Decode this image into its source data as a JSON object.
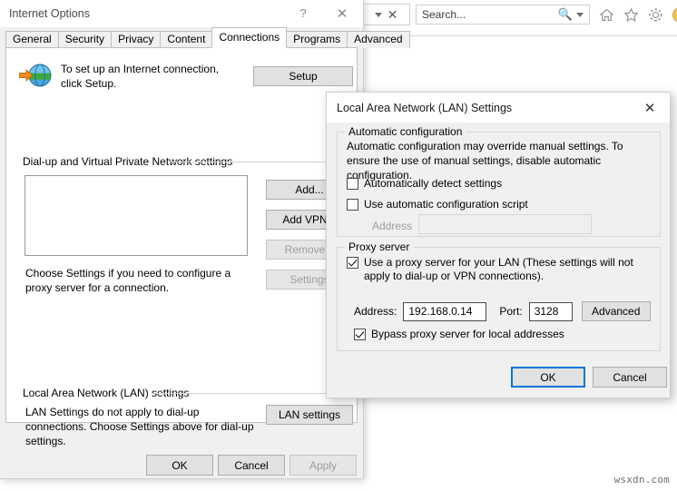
{
  "browser": {
    "address_controls": {
      "dropdown_icon": "chevron-down-icon",
      "close_icon": "close-icon"
    },
    "search": {
      "placeholder": "Search...",
      "magnifier_icon": "search-icon",
      "dropdown_icon": "chevron-down-icon"
    },
    "icons": [
      "home-icon",
      "favorites-star-icon",
      "gear-icon",
      "account-circle-icon"
    ]
  },
  "internet_options": {
    "title": "Internet Options",
    "help_button": "?",
    "close_button": "✕",
    "tabs": [
      {
        "label": "General",
        "active": false
      },
      {
        "label": "Security",
        "active": false
      },
      {
        "label": "Privacy",
        "active": false
      },
      {
        "label": "Content",
        "active": false
      },
      {
        "label": "Connections",
        "active": true
      },
      {
        "label": "Programs",
        "active": false
      },
      {
        "label": "Advanced",
        "active": false
      }
    ],
    "setup": {
      "icon": "globe-with-arrow-icon",
      "text": "To set up an Internet connection, click Setup.",
      "button": "Setup"
    },
    "dialup": {
      "group_label": "Dial-up and Virtual Private Network settings",
      "list_items": [],
      "help_text": "Choose Settings if you need to configure a proxy server for a connection.",
      "buttons": [
        {
          "label": "Add...",
          "disabled": false
        },
        {
          "label": "Add VPN...",
          "disabled": false
        },
        {
          "label": "Remove...",
          "disabled": true
        },
        {
          "label": "Settings",
          "disabled": true
        }
      ]
    },
    "lan": {
      "group_label": "Local Area Network (LAN) settings",
      "help_text": "LAN Settings do not apply to dial-up connections. Choose Settings above for dial-up settings.",
      "button": "LAN settings"
    },
    "footer_buttons": [
      {
        "label": "OK",
        "disabled": false
      },
      {
        "label": "Cancel",
        "disabled": false
      },
      {
        "label": "Apply",
        "disabled": true
      }
    ]
  },
  "lan_settings": {
    "title": "Local Area Network (LAN) Settings",
    "close_button": "✕",
    "automatic_configuration": {
      "group_label": "Automatic configuration",
      "description": "Automatic configuration may override manual settings.  To ensure the use of manual settings, disable automatic configuration.",
      "auto_detect": {
        "label": "Automatically detect settings",
        "checked": false
      },
      "auto_script": {
        "label": "Use automatic configuration script",
        "checked": false
      },
      "address_label": "Address",
      "address_value": "",
      "address_disabled": true
    },
    "proxy_server": {
      "group_label": "Proxy server",
      "use_proxy": {
        "label": "Use a proxy server for your LAN (These settings will not apply to dial-up or VPN connections).",
        "checked": true
      },
      "address_label": "Address:",
      "address_value": "192.168.0.14",
      "port_label": "Port:",
      "port_value": "3128",
      "advanced_button": "Advanced",
      "bypass": {
        "label": "Bypass proxy server for local addresses",
        "checked": true
      }
    },
    "footer_buttons": [
      {
        "label": "OK",
        "default": true
      },
      {
        "label": "Cancel",
        "default": false
      }
    ]
  },
  "watermark": "wsxdn.com",
  "colors": {
    "accent": "#0078d7",
    "button_face": "#e1e1e1",
    "dialog_face": "#f0f0f0"
  }
}
